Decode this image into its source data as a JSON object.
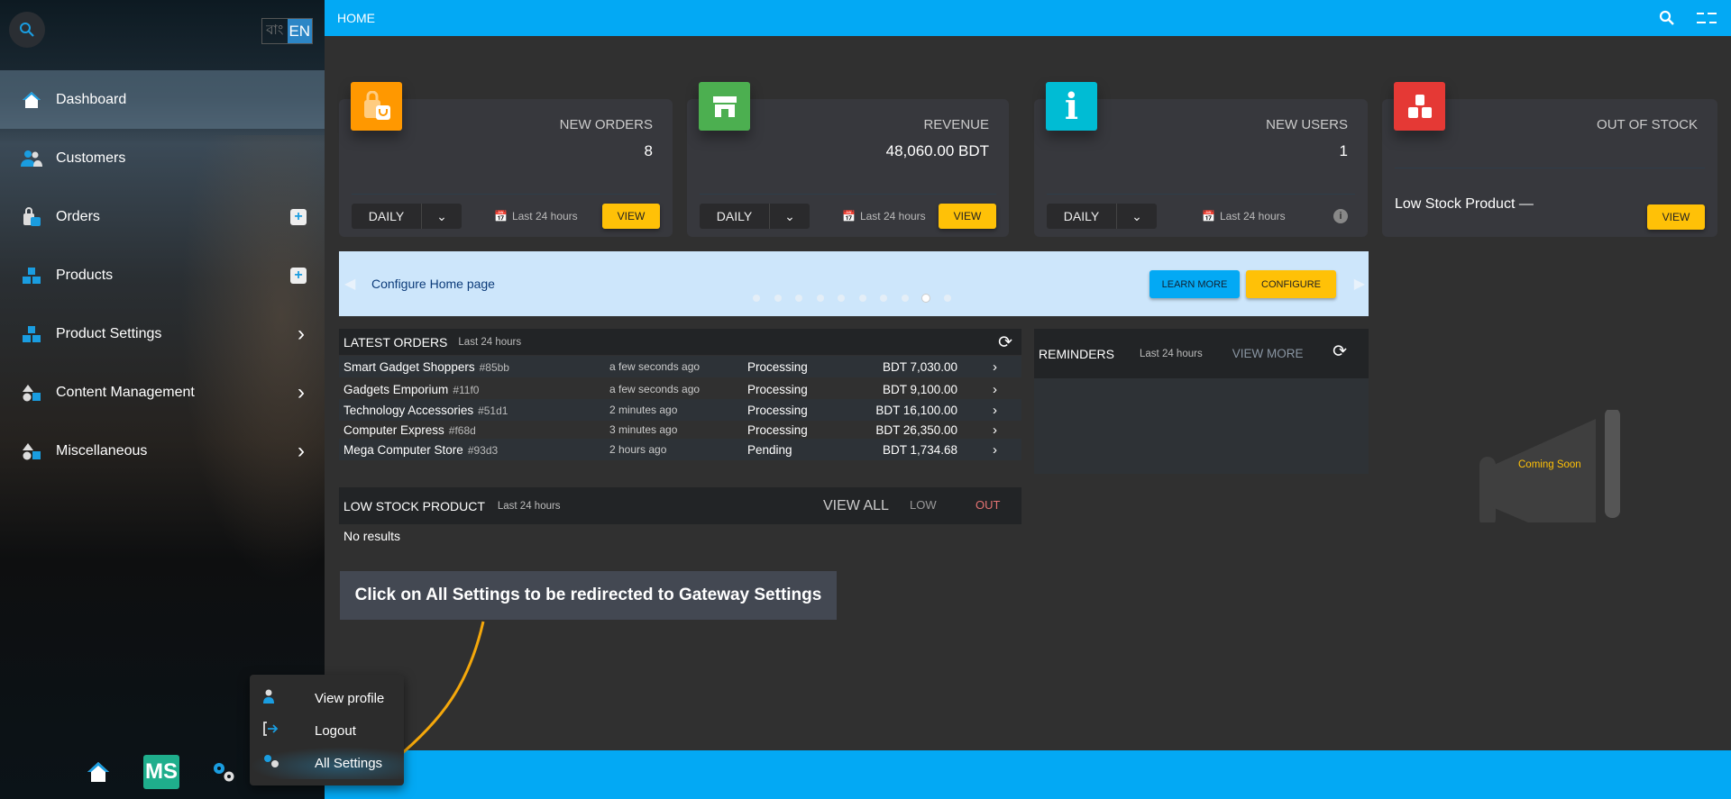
{
  "sidebar": {
    "lang": {
      "bn": "বাং",
      "en": "EN"
    },
    "items": [
      {
        "label": "Dashboard",
        "icon": "home-icon",
        "active": true
      },
      {
        "label": "Customers",
        "icon": "users-icon"
      },
      {
        "label": "Orders",
        "icon": "shopping-bag-icon",
        "action": "plus"
      },
      {
        "label": "Products",
        "icon": "boxes-icon",
        "action": "plus"
      },
      {
        "label": "Product Settings",
        "icon": "boxes-icon",
        "action": "chevron"
      },
      {
        "label": "Content Management",
        "icon": "shapes-icon",
        "action": "chevron"
      },
      {
        "label": "Miscellaneous",
        "icon": "shapes-icon",
        "action": "chevron"
      }
    ],
    "logo": "MS"
  },
  "topbar": {
    "title": "HOME"
  },
  "cards": [
    {
      "title": "NEW ORDERS",
      "value": "8",
      "period": "DAILY",
      "range": "Last 24 hours",
      "button": "VIEW",
      "color": "#ff9800"
    },
    {
      "title": "REVENUE",
      "value": "48,060.00 BDT",
      "period": "DAILY",
      "range": "Last 24 hours",
      "button": "VIEW",
      "color": "#4caf50"
    },
    {
      "title": "NEW USERS",
      "value": "1",
      "period": "DAILY",
      "range": "Last 24 hours",
      "color": "#00bcd4"
    },
    {
      "title": "OUT OF STOCK",
      "subtitle": "Low Stock Product —",
      "button": "VIEW",
      "color": "#e53935"
    }
  ],
  "banner": {
    "text": "Configure Home page",
    "learn_more": "LEARN MORE",
    "configure": "CONFIGURE",
    "slides": 10,
    "active_slide": 9
  },
  "latest_orders": {
    "title": "LATEST ORDERS",
    "range": "Last 24 hours",
    "rows": [
      {
        "name": "Smart Gadget Shoppers",
        "id": "#85bb",
        "time": "a few seconds ago",
        "status": "Processing",
        "amount": "BDT 7,030.00"
      },
      {
        "name": "Gadgets Emporium",
        "id": "#11f0",
        "time": "a few seconds ago",
        "status": "Processing",
        "amount": "BDT 9,100.00"
      },
      {
        "name": "Technology Accessories",
        "id": "#51d1",
        "time": "2 minutes ago",
        "status": "Processing",
        "amount": "BDT 16,100.00"
      },
      {
        "name": "Computer Express",
        "id": "#f68d",
        "time": "3 minutes ago",
        "status": "Processing",
        "amount": "BDT 26,350.00"
      },
      {
        "name": "Mega Computer Store",
        "id": "#93d3",
        "time": "2 hours ago",
        "status": "Pending",
        "amount": "BDT 1,734.68"
      }
    ]
  },
  "low_stock": {
    "title": "LOW STOCK PRODUCT",
    "range": "Last 24 hours",
    "view_all": "VIEW ALL",
    "low": "LOW",
    "out": "OUT",
    "empty": "No results"
  },
  "reminders": {
    "title": "REMINDERS",
    "range": "Last 24 hours",
    "view_more": "VIEW MORE"
  },
  "coming_soon": "Coming Soon",
  "callout": "Click on All Settings to be redirected to Gateway Settings",
  "popup": {
    "items": [
      "View profile",
      "Logout",
      "All Settings"
    ]
  }
}
